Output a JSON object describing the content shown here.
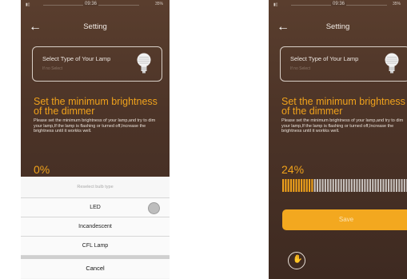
{
  "status": {
    "time": "09:36",
    "battery": "35%"
  },
  "header": {
    "back_icon": "back-arrow-icon",
    "title": "Setting"
  },
  "lamp_select": {
    "label": "Select Type of Your Lamp",
    "hint": "If no Select",
    "icon": "bulb-icon"
  },
  "dimmer": {
    "heading": "Set the minimum brightness of the dimmer",
    "description": "Please set the minimum brightness of your lamp,and try to dim your lamp,If the lamp is flashing or turned off,Increase the brightness until it workks well."
  },
  "left_screen": {
    "percent": "0%",
    "sheet": {
      "header": "Reselect bulb type",
      "options": [
        "LED",
        "Incandescent",
        "CFL Lamp"
      ],
      "cancel": "Cancel"
    }
  },
  "right_screen": {
    "percent": "24%",
    "slider_value": 0.24,
    "save_label": "Save",
    "fab_icon": "hand-touch-icon"
  },
  "colors": {
    "accent": "#f0a21b",
    "background": "#4b3327",
    "sheet": "#f5f5f5"
  }
}
